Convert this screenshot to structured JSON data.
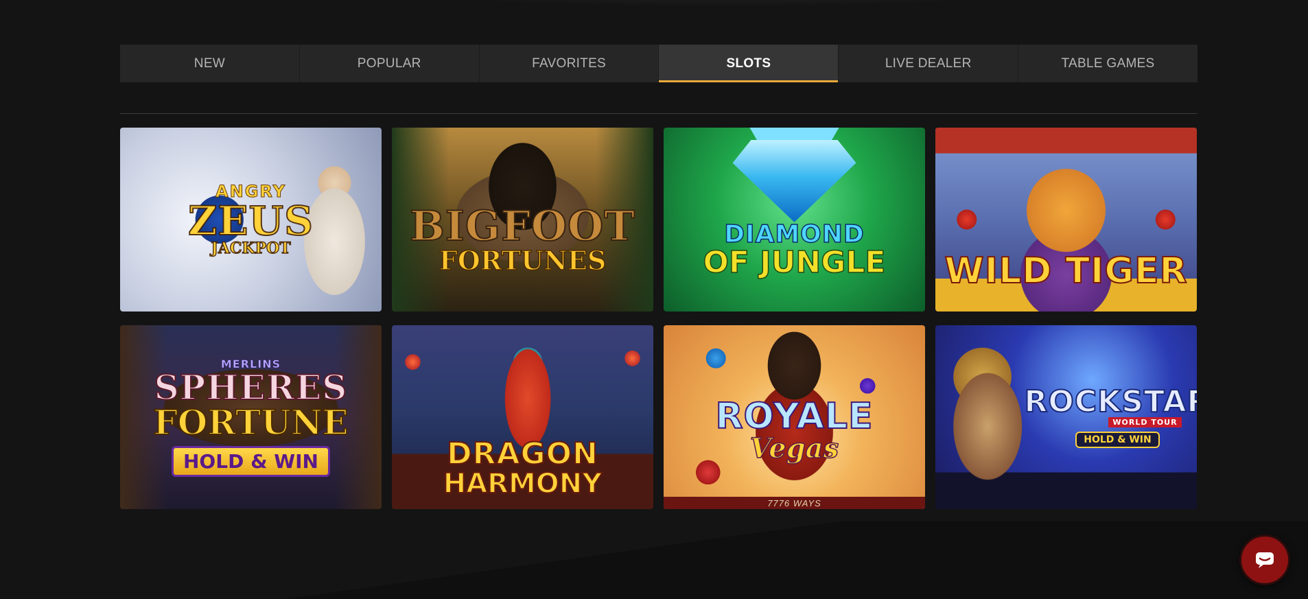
{
  "tabs": [
    {
      "label": "NEW",
      "active": false
    },
    {
      "label": "POPULAR",
      "active": false
    },
    {
      "label": "FAVORITES",
      "active": false
    },
    {
      "label": "SLOTS",
      "active": true
    },
    {
      "label": "LIVE DEALER",
      "active": false
    },
    {
      "label": "TABLE GAMES",
      "active": false
    }
  ],
  "accent_color": "#e8a93a",
  "games": [
    {
      "sup": "ANGRY",
      "main": "ZEUS",
      "sub": "JACKPOT"
    },
    {
      "main": "BIGFOOT",
      "sub": "FORTUNES"
    },
    {
      "main": "DIAMOND",
      "sub": "OF JUNGLE"
    },
    {
      "main": "WILD TIGER"
    },
    {
      "sup": "MERLINS",
      "main": "SPHERES",
      "sub": "FORTUNE",
      "badge": "HOLD & WIN"
    },
    {
      "main": "DRAGON",
      "sub": "HARMONY"
    },
    {
      "main": "ROYALE",
      "sub": "Vegas",
      "strip": "7776 WAYS"
    },
    {
      "main": "ROCKSTAR",
      "sup": "WORLD TOUR",
      "badge": "HOLD & WIN"
    }
  ],
  "chat": {
    "icon": "chat-icon"
  }
}
